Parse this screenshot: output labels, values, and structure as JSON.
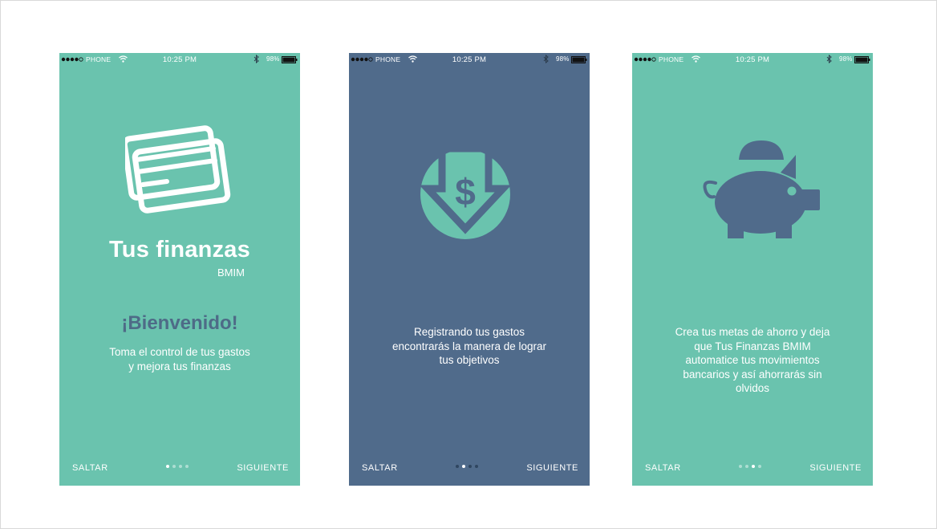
{
  "colors": {
    "green": "#6ac3ae",
    "blue": "#506b8b",
    "white": "#ffffff",
    "dark_blue_text": "#4e6b87"
  },
  "status_bar": {
    "carrier": "PHONE",
    "time": "10:25 PM",
    "battery": "98%",
    "signal_dots": 5,
    "signal_filled": 4
  },
  "screens": [
    {
      "brand_title": "Tus finanzas",
      "brand_subtitle": "BMIM",
      "welcome": "¡Bienvenido!",
      "body": "Toma el control de tus gastos\ny mejora tus finanzas",
      "hero_icon": "credit-cards-icon",
      "skip_label": "SALTAR",
      "next_label": "SIGUIENTE",
      "active_page": 1,
      "total_pages": 4
    },
    {
      "body": "Registrando tus gastos\nencontrarás la manera de lograr\ntus objetivos",
      "hero_icon": "dollar-download-icon",
      "skip_label": "SALTAR",
      "next_label": "SIGUIENTE",
      "active_page": 2,
      "total_pages": 4
    },
    {
      "body": "Crea tus metas de ahorro y deja\nque Tus Finanzas BMIM\nautomatice tus movimientos\nbancarios y así ahorrarás sin\nolvidos",
      "hero_icon": "piggy-bank-icon",
      "skip_label": "SALTAR",
      "next_label": "SIGUIENTE",
      "active_page": 3,
      "total_pages": 4
    }
  ]
}
